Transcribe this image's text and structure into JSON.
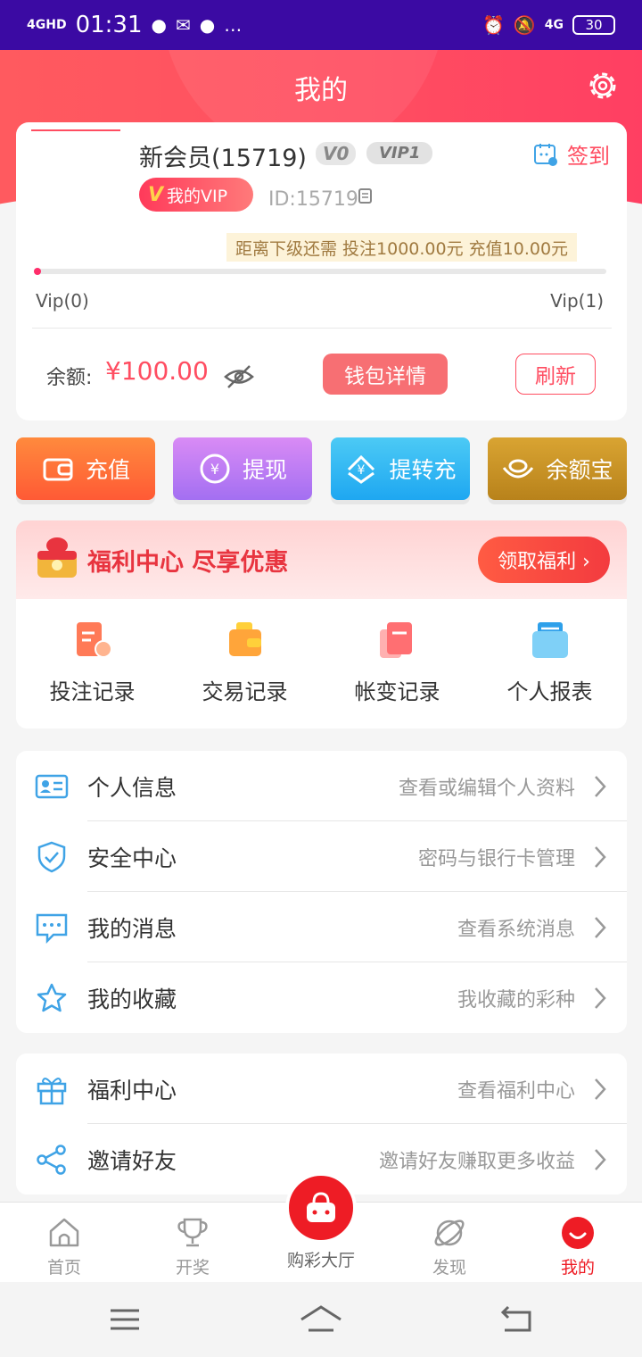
{
  "status_bar": {
    "signal": "4GHD",
    "time": "01:31",
    "network": "4G",
    "battery": "30",
    "more": "…"
  },
  "header": {
    "title": "我的",
    "settings_icon": "gear-icon"
  },
  "user": {
    "name": "新会员(15719)",
    "level_badge": "V0",
    "next_badge": "VIP1",
    "signin_label": "签到",
    "vip_button": "我的VIP",
    "vip_v": "V",
    "id_text": "ID:15719",
    "next_level_text": "距离下级还需  投注1000.00元  充值10.00元",
    "progress_percent": 0,
    "vip_from": "Vip(0)",
    "vip_to": "Vip(1)",
    "balance_label": "余额:",
    "balance_amount": "¥100.00",
    "wallet_button": "钱包详情",
    "refresh_button": "刷新"
  },
  "actions": [
    {
      "label": "充值",
      "icon": "wallet-icon"
    },
    {
      "label": "提现",
      "icon": "yen-out-icon"
    },
    {
      "label": "提转充",
      "icon": "yen-transfer-icon"
    },
    {
      "label": "余额宝",
      "icon": "ingot-icon"
    }
  ],
  "welfare": {
    "title": "福利中心 尽享优惠",
    "button": "领取福利 ›",
    "records": [
      {
        "label": "投注记录",
        "icon": "bet-record-icon"
      },
      {
        "label": "交易记录",
        "icon": "trade-record-icon"
      },
      {
        "label": "帐变记录",
        "icon": "account-change-icon"
      },
      {
        "label": "个人报表",
        "icon": "report-icon"
      }
    ]
  },
  "menu_primary": [
    {
      "title": "个人信息",
      "desc": "查看或编辑个人资料",
      "icon": "id-card-icon"
    },
    {
      "title": "安全中心",
      "desc": "密码与银行卡管理",
      "icon": "shield-icon"
    },
    {
      "title": "我的消息",
      "desc": "查看系统消息",
      "icon": "message-icon"
    },
    {
      "title": "我的收藏",
      "desc": "我收藏的彩种",
      "icon": "star-icon"
    }
  ],
  "menu_secondary": [
    {
      "title": "福利中心",
      "desc": "查看福利中心",
      "icon": "gift-icon"
    },
    {
      "title": "邀请好友",
      "desc": "邀请好友赚取更多收益",
      "icon": "share-icon"
    }
  ],
  "tabs": [
    {
      "label": "首页",
      "icon": "home-icon"
    },
    {
      "label": "开奖",
      "icon": "trophy-icon"
    },
    {
      "label": "购彩大厅",
      "icon": "basket-icon"
    },
    {
      "label": "发现",
      "icon": "planet-icon"
    },
    {
      "label": "我的",
      "icon": "smile-icon"
    }
  ],
  "colors": {
    "accent": "#ff4d61",
    "tab_active": "#ee1c25",
    "icon_blue": "#3fa3e6"
  }
}
